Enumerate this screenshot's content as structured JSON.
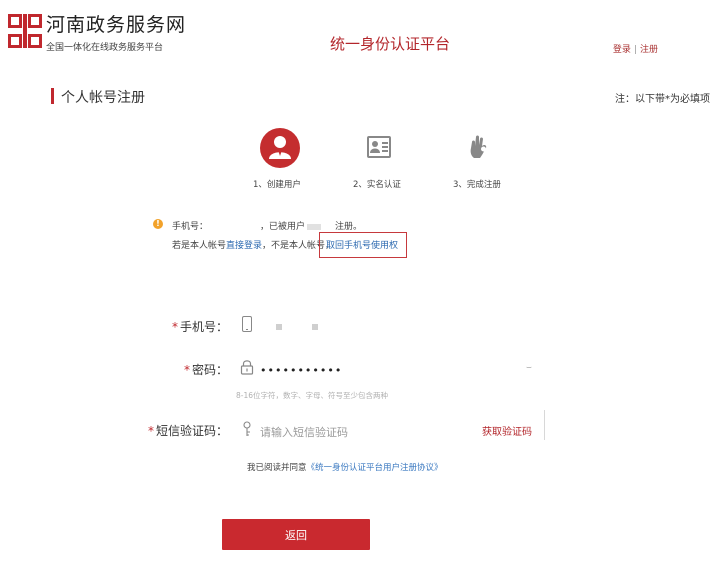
{
  "header": {
    "logo_icon": "henan-logo-icon",
    "site_name": "河南政务服务网",
    "site_tagline": "全国一体化在线政务服务平台",
    "platform_title": "统一身份认证平台",
    "login_link": "登录",
    "separator": "|",
    "register_link": "注册"
  },
  "section": {
    "title": "个人帐号注册",
    "required_note": "注：以下带*为必填项"
  },
  "steps": [
    {
      "label": "1、创建用户",
      "icon": "user-icon",
      "active": true
    },
    {
      "label": "2、实名认证",
      "icon": "id-card-icon",
      "active": false
    },
    {
      "label": "3、完成注册",
      "icon": "ok-hand-icon",
      "active": false
    }
  ],
  "warning": {
    "icon": "warning-icon",
    "phone_prefix": "手机号：",
    "phone_used": "，已被用户",
    "registered": "注册。",
    "line2_prefix": "若是本人帐号",
    "direct_login": "直接登录",
    "line2_mid": "，不是本人帐号，",
    "reclaim_link": "取回手机号使用权"
  },
  "form": {
    "phone_label": "手机号：",
    "password_label": "密码：",
    "password_value": "•••••••••••",
    "password_hint": "8-16位字符，数字、字母、符号至少包含两种",
    "sms_label": "短信验证码：",
    "sms_placeholder": "请输入短信验证码",
    "get_code_button": "获取验证码",
    "required_mark": "*",
    "agree_prefix": "我已阅读并同意",
    "agreement_link": "《统一身份认证平台用户注册协议》"
  },
  "back_button": "返回",
  "colors": {
    "brand_red": "#c42d2f",
    "link_blue": "#2d6ab0",
    "warning_orange": "#f2a22a"
  }
}
